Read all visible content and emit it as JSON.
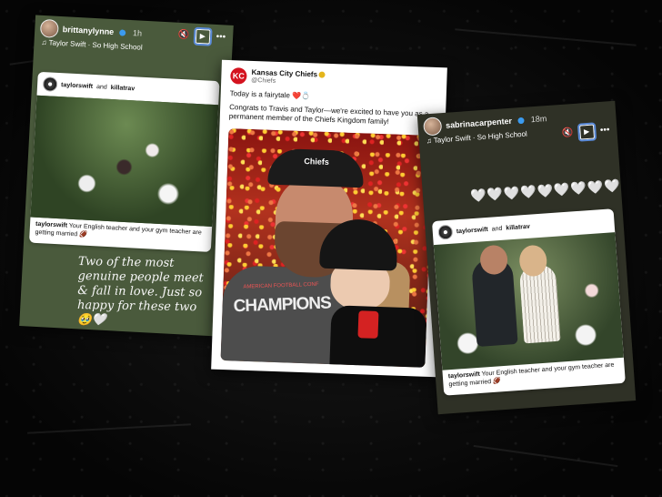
{
  "left_story": {
    "username": "brittanylynne",
    "time": "1h",
    "song": "Taylor Swift · So High School",
    "post": {
      "user1": "taylorswift",
      "conj": "and",
      "user2": "killatrav",
      "caption_user": "taylorswift",
      "caption_text": "Your English teacher and your gym teacher are getting married 🏈"
    },
    "overlay_text": "Two of the most genuine people meet & fall in love. Just so happy for these two 🥹🤍"
  },
  "tweet": {
    "account_name": "Kansas City Chiefs",
    "handle": "@Chiefs",
    "logo_text": "KC",
    "line1": "Today is a fairytale ❤️💍",
    "line2": "Congrats to Travis and Taylor—we're excited to have you as a permanent member of the Chiefs Kingdom family!",
    "hat_text": "Chiefs",
    "shirt_text": "CHAMPIONS",
    "shirt_subtext": "AMERICAN FOOTBALL CONF"
  },
  "right_story": {
    "username": "sabrinacarpenter",
    "time": "18m",
    "song": "Taylor Swift · So High School",
    "hearts": "🤍🤍🤍🤍🤍🤍🤍🤍🤍",
    "post": {
      "user1": "taylorswift",
      "conj": "and",
      "user2": "killatrav",
      "caption_user": "taylorswift",
      "caption_text": "Your English teacher and your gym teacher are getting married 🏈"
    }
  },
  "icons": {
    "mute": "🔇",
    "play": "▶",
    "more": "•••"
  }
}
